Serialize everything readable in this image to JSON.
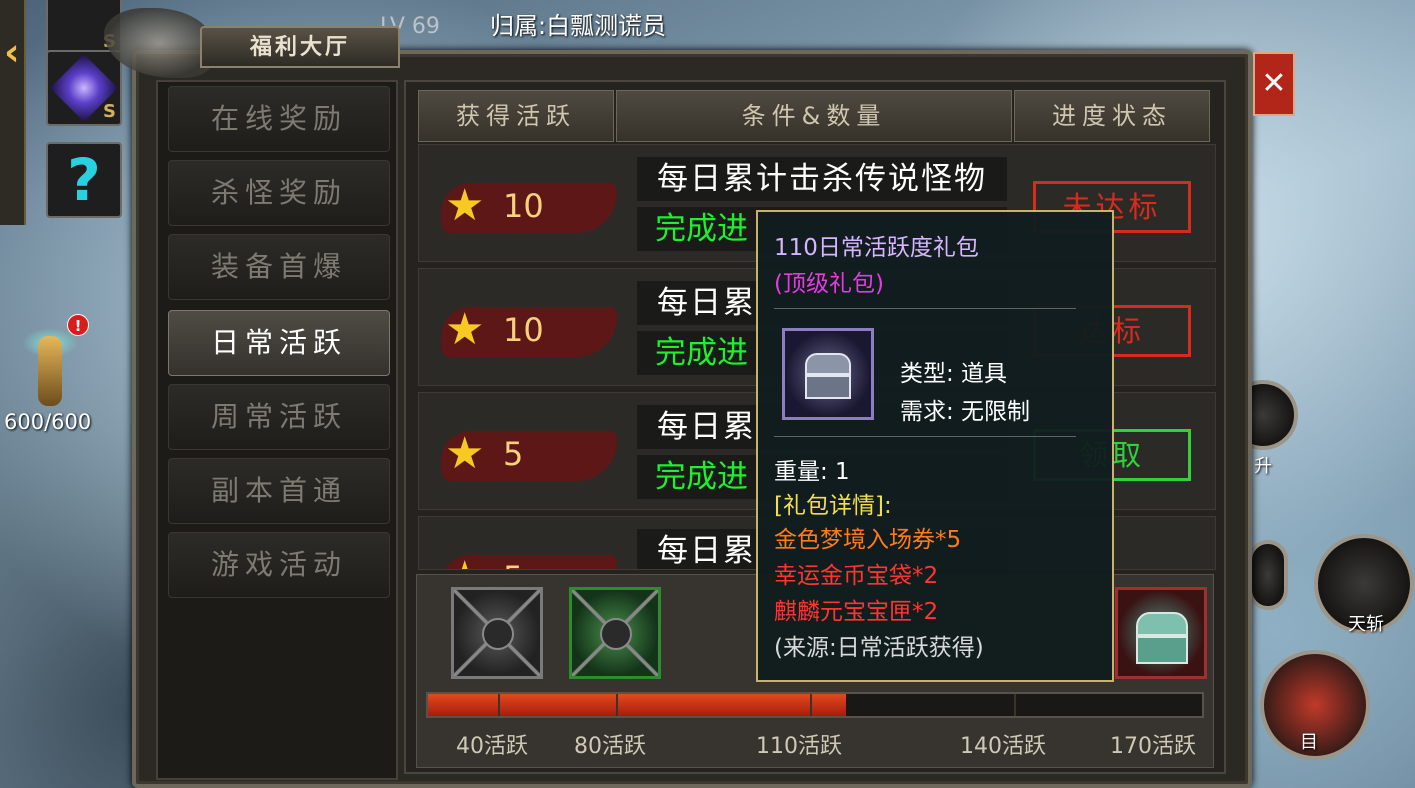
{
  "top": {
    "level_text": "LV 69",
    "owner_text": "归属:白瓢测谎员"
  },
  "left_panel": {
    "hp_text": "600/600",
    "alert_badge": "!",
    "help_icon": "?",
    "item_tag": "S"
  },
  "window": {
    "title": "福利大厅",
    "close_label": "✕"
  },
  "menu": {
    "items": [
      {
        "label": "在线奖励",
        "active": false
      },
      {
        "label": "杀怪奖励",
        "active": false
      },
      {
        "label": "装备首爆",
        "active": false
      },
      {
        "label": "日常活跃",
        "active": true
      },
      {
        "label": "周常活跃",
        "active": false
      },
      {
        "label": "副本首通",
        "active": false
      },
      {
        "label": "游戏活动",
        "active": false
      }
    ]
  },
  "table": {
    "headers": [
      "获得活跃",
      "条件&数量",
      "进度状态"
    ],
    "rows": [
      {
        "points": "10",
        "task": "每日累计击杀传说怪物",
        "progress": "完成进",
        "status": "未达标"
      },
      {
        "points": "10",
        "task": "每日累",
        "progress": "完成进",
        "status": "达标"
      },
      {
        "points": "5",
        "task": "每日累",
        "progress": "完成进",
        "status": "领取"
      },
      {
        "points": "5",
        "task": "每日累",
        "progress": "",
        "status": ""
      }
    ]
  },
  "progress_bar": {
    "fill_fraction": 0.54,
    "milestones": [
      "40活跃",
      "80活跃",
      "110活跃",
      "140活跃",
      "170活跃"
    ]
  },
  "tooltip": {
    "title": "110日常活跃度礼包",
    "subtitle": "(顶级礼包)",
    "type_line": "类型: 道具",
    "req_line": "需求: 无限制",
    "weight_line": "重量: 1",
    "details_header": "[礼包详情]:",
    "items": [
      {
        "text": "金色梦境入场券*5",
        "color": "orange"
      },
      {
        "text": "幸运金币宝袋*2",
        "color": "red"
      },
      {
        "text": "麒麟元宝宝匣*2",
        "color": "red"
      }
    ],
    "source_line": "(来源:日常活跃获得)"
  },
  "skills": {
    "upgrade_label": "升",
    "sword_label": "天斩",
    "target_label": "目"
  },
  "colors": {
    "status_red": "#d72b1c",
    "status_green": "#2ed23a",
    "progress_green": "#1df02d",
    "star": "#f8c823"
  }
}
